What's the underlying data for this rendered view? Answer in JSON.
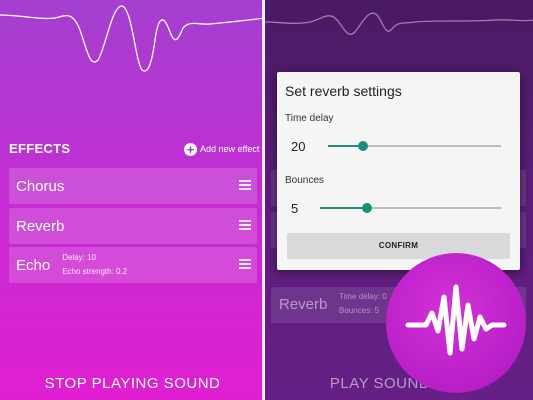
{
  "left_screen": {
    "effects_header": "EFFECTS",
    "add_effect_label": "Add new effect",
    "effects": [
      {
        "name": "Chorus"
      },
      {
        "name": "Reverb"
      },
      {
        "name": "Echo",
        "params": [
          "Delay: 10",
          "Echo strength: 0.2"
        ]
      }
    ],
    "bottom_button": "STOP PLAYING SOUND"
  },
  "right_screen": {
    "dialog": {
      "title": "Set reverb settings",
      "time_delay_label": "Time delay",
      "time_delay_value": "20",
      "time_delay_fraction": 0.2,
      "bounces_label": "Bounces",
      "bounces_value": "5",
      "bounces_fraction": 0.26,
      "confirm_label": "CONFIRM"
    },
    "background_card": {
      "name": "Reverb",
      "params": [
        "Time delay: 0",
        "Bounces: 5"
      ]
    },
    "bottom_button": "PLAY SOUND"
  },
  "colors": {
    "accent": "#1e8c80",
    "left_gradient_top": "#a43fd0",
    "left_gradient_bottom": "#e01ed2",
    "logo": "#c126cf"
  },
  "icons": {
    "add": "plus-circle-icon",
    "drag": "drag-handle-icon",
    "logo": "sound-wave-logo-icon"
  }
}
